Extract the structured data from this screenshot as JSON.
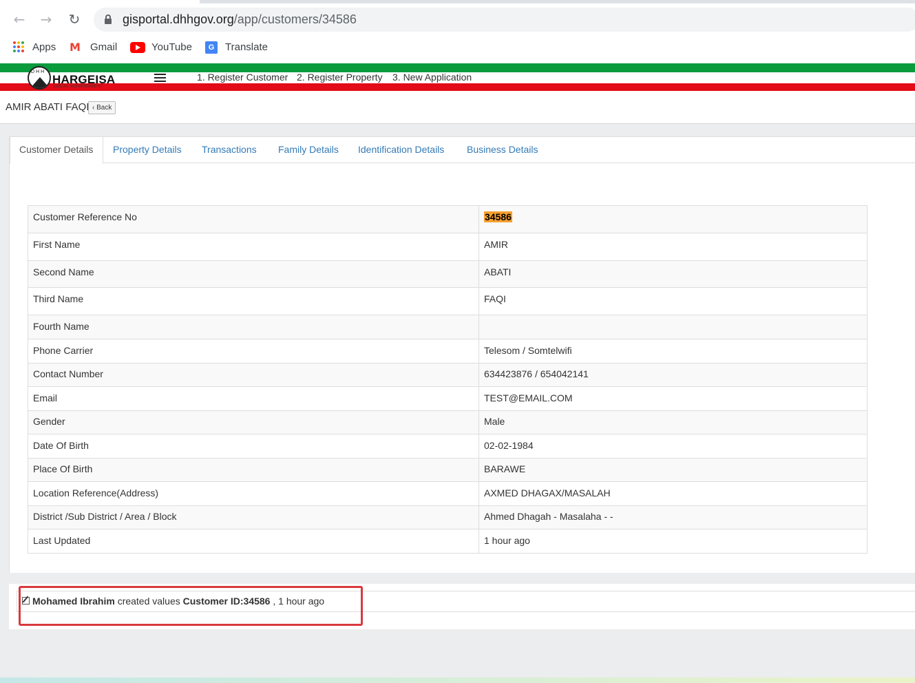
{
  "browser": {
    "url_host": "gisportal.dhhgov.org",
    "url_path": "/app/customers/34586",
    "bookmarks": [
      "Apps",
      "Gmail",
      "YouTube",
      "Translate"
    ]
  },
  "header": {
    "logo_letters": "DHH",
    "logo_name": "HARGEISA",
    "logo_sub": "LOCAL GOVERNMENT",
    "nav": [
      "1. Register Customer",
      "2. Register Property",
      "3. New Application"
    ]
  },
  "page": {
    "title": "AMIR ABATI FAQI",
    "back_label": "Back"
  },
  "tabs": [
    "Customer Details",
    "Property Details",
    "Transactions",
    "Family Details",
    "Identification Details",
    "Business Details"
  ],
  "details": [
    {
      "label": "Customer Reference No",
      "value": "34586"
    },
    {
      "label": "First Name",
      "value": "AMIR"
    },
    {
      "label": "Second Name",
      "value": "ABATI"
    },
    {
      "label": "Third Name",
      "value": "FAQI"
    },
    {
      "label": "Fourth Name",
      "value": ""
    },
    {
      "label": "Phone Carrier",
      "value": "Telesom / Somtelwifi"
    },
    {
      "label": "Contact Number",
      "value": "634423876 / 654042141"
    },
    {
      "label": "Email",
      "value": "TEST@EMAIL.COM"
    },
    {
      "label": "Gender",
      "value": "Male"
    },
    {
      "label": "Date Of Birth",
      "value": "02-02-1984"
    },
    {
      "label": "Place Of Birth",
      "value": "BARAWE"
    },
    {
      "label": "Location Reference(Address)",
      "value": "AXMED DHAGAX/MASALAH"
    },
    {
      "label": "District /Sub District / Area / Block",
      "value": "Ahmed Dhagah - Masalaha - -"
    },
    {
      "label": "Last Updated",
      "value": "1 hour ago"
    }
  ],
  "activity": {
    "user": "Mohamed Ibrahim",
    "action": "created values",
    "target": "Customer ID:34586",
    "time": ", 1 hour ago"
  },
  "colors": {
    "green_band": "#0a9b3d",
    "red_band": "#e30b17",
    "link": "#337ab7",
    "highlight": "#f7a030",
    "annotation_box": "#d9393d"
  }
}
